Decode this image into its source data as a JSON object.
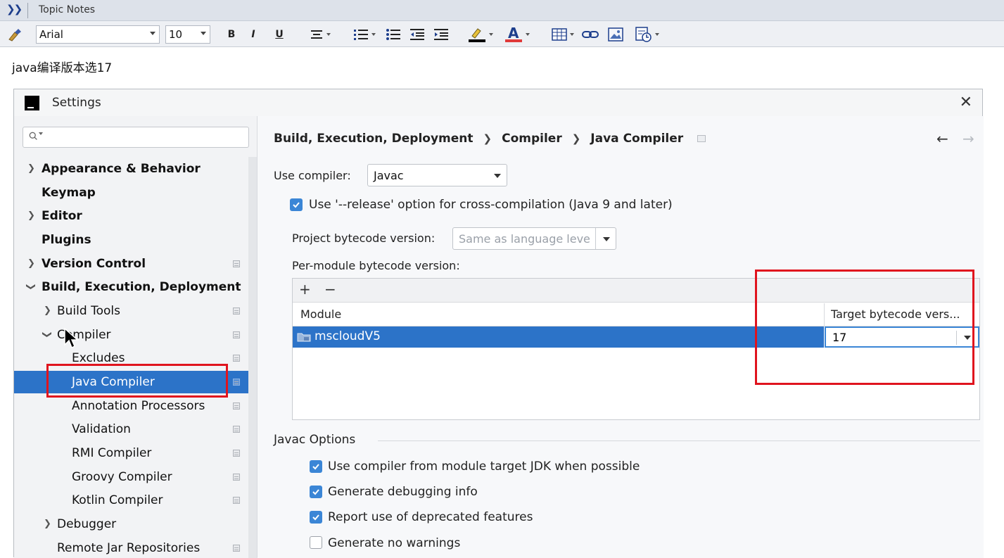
{
  "notes": {
    "header_title": "Topic Notes",
    "note_text": "java编译版本选17"
  },
  "toolbar": {
    "font_name": "Arial",
    "font_size": "10",
    "bold": "B",
    "italic": "I",
    "underline": "U",
    "font_color_glyph": "A"
  },
  "settings": {
    "title": "Settings",
    "nav": {
      "items": [
        {
          "label": "Appearance & Behavior"
        },
        {
          "label": "Keymap"
        },
        {
          "label": "Editor"
        },
        {
          "label": "Plugins"
        },
        {
          "label": "Version Control"
        },
        {
          "label": "Build, Execution, Deployment"
        },
        {
          "label": "Build Tools"
        },
        {
          "label": "Compiler"
        },
        {
          "label": "Excludes"
        },
        {
          "label": "Java Compiler"
        },
        {
          "label": "Annotation Processors"
        },
        {
          "label": "Validation"
        },
        {
          "label": "RMI Compiler"
        },
        {
          "label": "Groovy Compiler"
        },
        {
          "label": "Kotlin Compiler"
        },
        {
          "label": "Debugger"
        },
        {
          "label": "Remote Jar Repositories"
        }
      ]
    },
    "breadcrumb": {
      "part1": "Build, Execution, Deployment",
      "part2": "Compiler",
      "part3": "Java Compiler"
    },
    "use_compiler_label": "Use compiler:",
    "use_compiler_value": "Javac",
    "release_option_label": "Use '--release' option for cross-compilation (Java 9 and later)",
    "project_bytecode_label": "Project bytecode version:",
    "project_bytecode_placeholder": "Same as language leve",
    "per_module_label": "Per-module bytecode version:",
    "table": {
      "col_module": "Module",
      "col_target": "Target bytecode vers...",
      "rows": [
        {
          "module": "mscloudV5",
          "target": "17"
        }
      ]
    },
    "javac_options": {
      "title": "Javac Options",
      "options": [
        {
          "label": "Use compiler from module target JDK when possible",
          "checked": true
        },
        {
          "label": "Generate debugging info",
          "checked": true
        },
        {
          "label": "Report use of deprecated features",
          "checked": true
        },
        {
          "label": "Generate no warnings",
          "checked": false
        }
      ]
    }
  },
  "colors": {
    "selection": "#2c73c8",
    "highlight_box": "#e0141e",
    "checkbox": "#3b86d6"
  }
}
